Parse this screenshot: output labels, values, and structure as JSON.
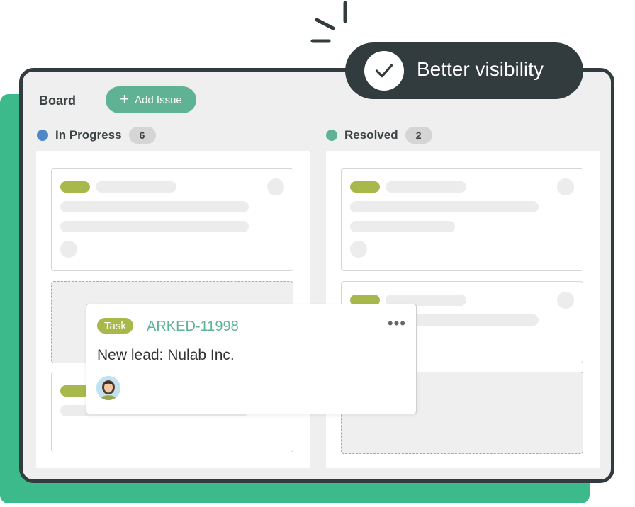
{
  "board": {
    "title": "Board",
    "add_issue_label": "Add Issue"
  },
  "columns": [
    {
      "name": "In Progress",
      "count": "6",
      "color": "#4f86c6"
    },
    {
      "name": "Resolved",
      "count": "2",
      "color": "#5fb394"
    }
  ],
  "popup_card": {
    "type": "Task",
    "key": "ARKED-11998",
    "summary": "New lead: Nulab Inc.",
    "more_label": "•••"
  },
  "highlight": {
    "label": "Better visibility"
  },
  "icons": [
    "plus-icon",
    "check-icon",
    "more-icon",
    "avatar",
    "sparkle-icon"
  ],
  "colors": {
    "accent": "#5fb394",
    "pill": "#a8b84b",
    "backdrop": "#3dba8c",
    "frame": "#323b3d"
  }
}
